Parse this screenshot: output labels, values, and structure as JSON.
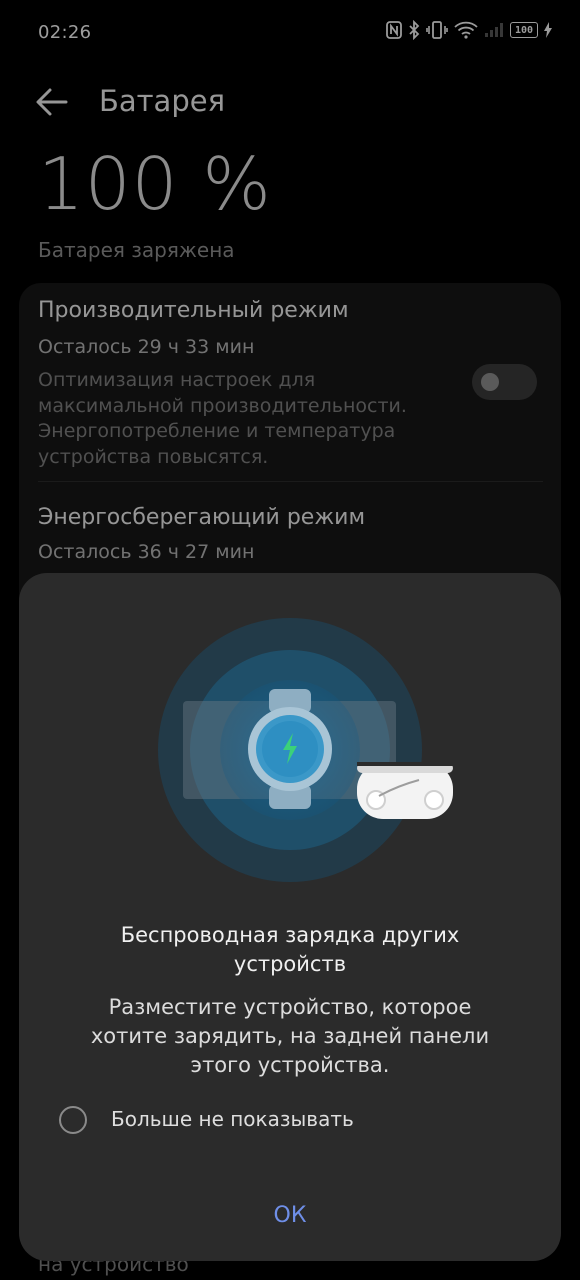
{
  "status": {
    "time": "02:26",
    "battery_level": "100"
  },
  "header": {
    "title": "Батарея",
    "back_icon": "arrow-left-icon"
  },
  "battery": {
    "percent": "100 %",
    "state": "Батарея заряжена"
  },
  "modes": [
    {
      "title": "Производительный режим",
      "remaining": "Осталось 29 ч 33 мин",
      "description": "Оптимизация настроек для максимальной производительности. Энергопотребление и температура устройства повысятся.",
      "enabled": false
    },
    {
      "title": "Энергосберегающий режим",
      "remaining": "Осталось 36 ч 27 мин"
    }
  ],
  "peek_text": "на устройство",
  "dialog": {
    "title": "Беспроводная зарядка других устройств",
    "body": "Разместите устройство, которое хотите зарядить, на задней панели этого устройства.",
    "checkbox_label": "Больше не показывать",
    "checkbox_checked": false,
    "ok_label": "ОК"
  }
}
